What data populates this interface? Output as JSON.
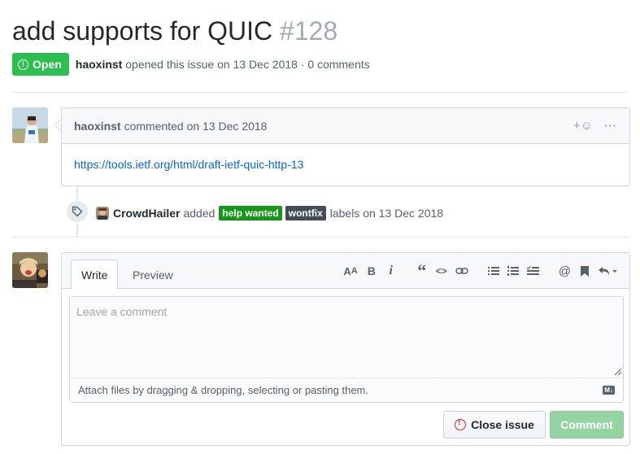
{
  "issue": {
    "title": "add supports for QUIC",
    "number": "#128",
    "status": "Open",
    "author": "haoxinst",
    "opened_text": "opened this issue on 13 Dec 2018 · 0 comments"
  },
  "comment": {
    "author": "haoxinst",
    "meta": "commented on 13 Dec 2018",
    "reaction_icon": "+☺",
    "more_icon": "···",
    "link": "https://tools.ietf.org/html/draft-ietf-quic-http-13"
  },
  "event": {
    "actor": "CrowdHailer",
    "action": "added",
    "labels": [
      {
        "name": "help wanted",
        "color": "#159818"
      },
      {
        "name": "wontfix",
        "color": "#444c56"
      }
    ],
    "suffix": "labels on 13 Dec 2018"
  },
  "editor": {
    "tab_write": "Write",
    "tab_preview": "Preview",
    "placeholder": "Leave a comment",
    "attach_text": "Attach files by dragging & dropping, selecting or pasting them.",
    "close_label": "Close issue",
    "comment_label": "Comment"
  },
  "colors": {
    "open_green": "#2cbe4e",
    "link_blue": "#0366d6",
    "comment_button_disabled": "#94d3a2"
  }
}
